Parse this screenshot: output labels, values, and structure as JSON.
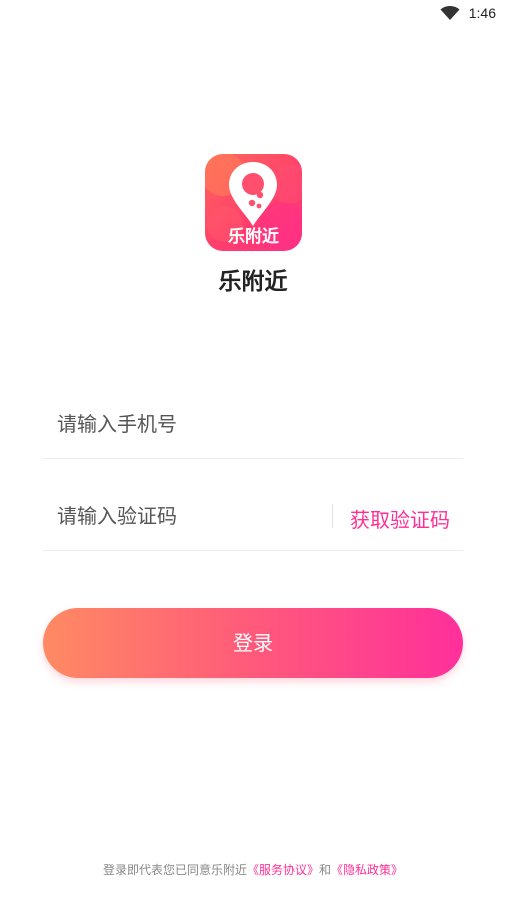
{
  "status_bar": {
    "time": "1:46",
    "wifi_icon": "wifi-icon"
  },
  "logo": {
    "badge_text": "乐附近",
    "icon": "location-pin-icon",
    "colors": [
      "#ff6a5a",
      "#ff3f6c",
      "#ff2f86"
    ]
  },
  "app_name": "乐附近",
  "form": {
    "phone_placeholder": "请输入手机号",
    "code_placeholder": "请输入验证码",
    "get_code_label": "获取验证码"
  },
  "login_button": {
    "label": "登录",
    "gradient": [
      "#ff8a63",
      "#ff5e78",
      "#ff2f9b"
    ]
  },
  "agreement": {
    "prefix": "登录即代表您已同意乐附近",
    "service_link": "《服务协议》",
    "conjunction": "和",
    "privacy_link": "《隐私政策》"
  },
  "colors": {
    "accent": "#ff2f95",
    "text": "#222222",
    "muted": "#888888"
  }
}
